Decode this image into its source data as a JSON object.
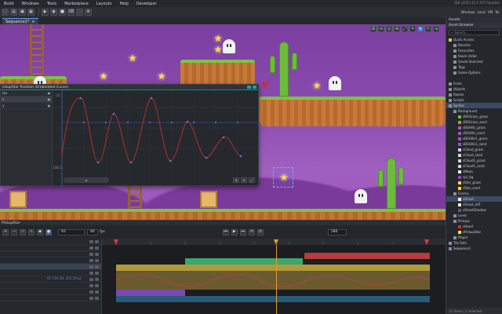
{
  "menubar": {
    "items": [
      "Build",
      "Windows",
      "Tools",
      "Marketplace",
      "Layouts",
      "Help",
      "Developer"
    ],
    "ide_version": "IDE v2023.11.1.157  Runtime"
  },
  "window_tabs": [
    "Windows",
    "Local",
    "VM",
    "Tar"
  ],
  "doc_tabs": [
    {
      "label": "Sequence1*",
      "close": "×"
    }
  ],
  "curve_editor": {
    "title": "ickupStar Position (Embedded Curve)",
    "rows": [
      {
        "label": "ion",
        "selected": false
      },
      {
        "label": "x",
        "selected": true
      },
      {
        "label": "y",
        "selected": false
      }
    ],
    "y_top": "-32",
    "y_bottom": "158.1",
    "footer_label": "y",
    "zoom": [
      "⊕",
      "⊖",
      "⤢"
    ]
  },
  "sequence": {
    "header": "PickupStar",
    "current_frame": "93",
    "length": "90",
    "fps_label": "fps",
    "end_frame": "180",
    "track_value": "0Y: 231.29, 255.29 px"
  },
  "assets": {
    "panel_title": "Assets",
    "browser_title": "Asset Browser",
    "search_placeholder": "Search...",
    "tree": [
      {
        "label": "Quick Access",
        "indent": 0,
        "color": "#e8c23a"
      },
      {
        "label": "Recents",
        "indent": 1,
        "color": "#8a9099"
      },
      {
        "label": "Favourites",
        "indent": 1,
        "color": "#8a9099"
      },
      {
        "label": "Room Order",
        "indent": 1,
        "color": "#8a9099"
      },
      {
        "label": "Saved Searches",
        "indent": 1,
        "color": "#8a9099"
      },
      {
        "label": "Tags",
        "indent": 1,
        "color": "#8a9099"
      },
      {
        "label": "Game Options",
        "indent": 1,
        "color": "#8a9099"
      },
      {
        "label": "",
        "indent": 0,
        "color": ""
      },
      {
        "label": "Fonts",
        "indent": 0,
        "color": "#8a9099"
      },
      {
        "label": "Objects",
        "indent": 0,
        "color": "#8a9099"
      },
      {
        "label": "Rooms",
        "indent": 0,
        "color": "#8a9099"
      },
      {
        "label": "Scripts",
        "indent": 0,
        "color": "#8a9099"
      },
      {
        "label": "Sprites",
        "indent": 0,
        "color": "#8a9099",
        "selected": true
      },
      {
        "label": "Background",
        "indent": 1,
        "color": "#8a9099"
      },
      {
        "label": "sBGGrass_grass",
        "indent": 2,
        "color": "#6cbc3a"
      },
      {
        "label": "sBGGrass_sand",
        "indent": 2,
        "color": "#c98a3a"
      },
      {
        "label": "sBGHills_grass",
        "indent": 2,
        "color": "#9a58b8"
      },
      {
        "label": "sBGHills_sand",
        "indent": 2,
        "color": "#9a58b8"
      },
      {
        "label": "sBGHills1_grass",
        "indent": 2,
        "color": "#9a58b8"
      },
      {
        "label": "sBGHills1_sand",
        "indent": 2,
        "color": "#9a58b8"
      },
      {
        "label": "sCloud_grass",
        "indent": 2,
        "color": "#d0d4da"
      },
      {
        "label": "sCloud_sand",
        "indent": 2,
        "color": "#d0d4da"
      },
      {
        "label": "sCloud1_grass",
        "indent": 2,
        "color": "#d0d4da"
      },
      {
        "label": "sCloud1_sand",
        "indent": 2,
        "color": "#d0d4da"
      },
      {
        "label": "sMoon",
        "indent": 2,
        "color": "#f0f0f0"
      },
      {
        "label": "spr_bg",
        "indent": 2,
        "color": "#8b4cb0"
      },
      {
        "label": "sStar_grass",
        "indent": 2,
        "color": "#ffd93a"
      },
      {
        "label": "sStar_sand",
        "indent": 2,
        "color": "#ffd93a"
      },
      {
        "label": "Enemy",
        "indent": 1,
        "color": "#8a9099"
      },
      {
        "label": "sGhost",
        "indent": 2,
        "color": "#f2f2f6",
        "selected": true
      },
      {
        "label": "sGhost_left",
        "indent": 2,
        "color": "#f2f2f6"
      },
      {
        "label": "sGhostShadow",
        "indent": 2,
        "color": "#5a6068"
      },
      {
        "label": "Level",
        "indent": 1,
        "color": "#8a9099"
      },
      {
        "label": "Pickups",
        "indent": 1,
        "color": "#8a9099"
      },
      {
        "label": "sHeart",
        "indent": 2,
        "color": "#d02a3a"
      },
      {
        "label": "sPickupStar",
        "indent": 2,
        "color": "#ffd93a"
      },
      {
        "label": "Player",
        "indent": 1,
        "color": "#8a9099"
      },
      {
        "label": "Tile Sets",
        "indent": 0,
        "color": "#8a9099"
      },
      {
        "label": "Sequence1",
        "indent": 0,
        "color": "#6a8ac8"
      }
    ],
    "footer": "21 items  |  1 selected"
  },
  "colors": {
    "accent": "#59a0ff",
    "teal": "#1aa3a3",
    "green_bar": "#3aa86a",
    "red_bar": "#b83a3a",
    "gold_bar": "#b09a3a",
    "purple_bar": "#7a4ab0"
  }
}
